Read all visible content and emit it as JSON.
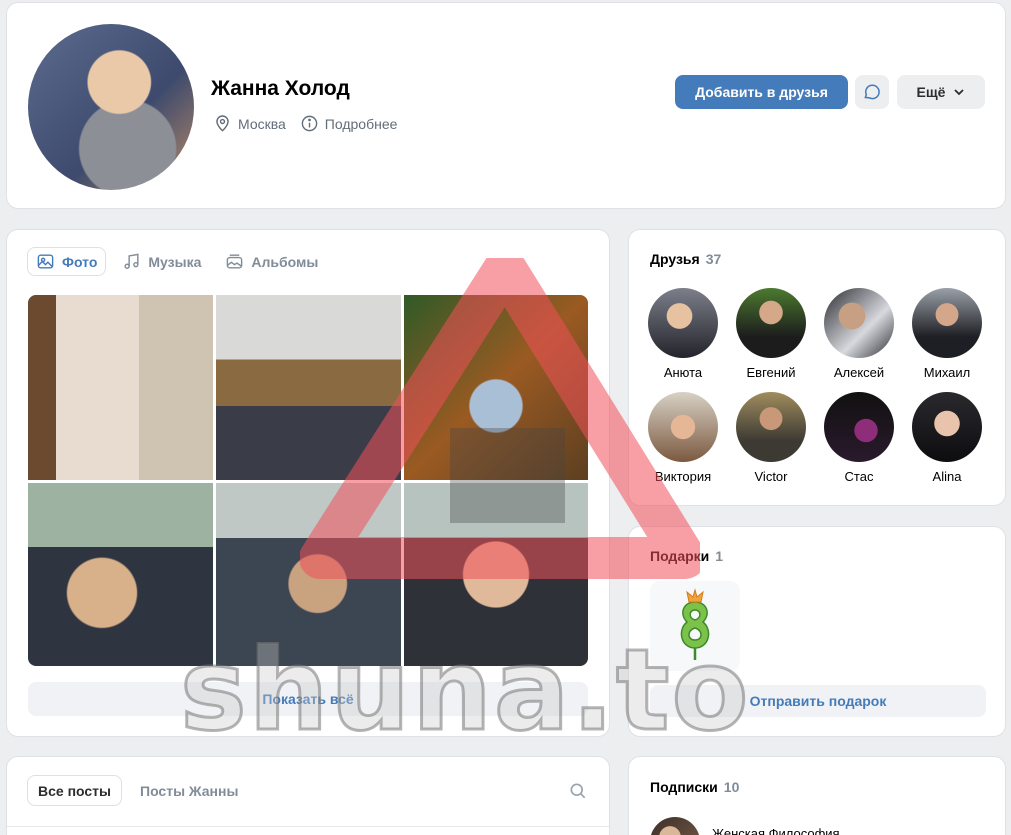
{
  "profile": {
    "name": "Жанна Холод",
    "city": "Москва",
    "details_label": "Подробнее",
    "add_friend_label": "Добавить в друзья",
    "more_label": "Ещё"
  },
  "photos_block": {
    "tabs": [
      {
        "label": "Фото",
        "icon": "photo-icon",
        "active": true
      },
      {
        "label": "Музыка",
        "icon": "music-icon",
        "active": false
      },
      {
        "label": "Альбомы",
        "icon": "albums-icon",
        "active": false
      }
    ],
    "show_all_label": "Показать всё",
    "photo_count_in_grid": 6
  },
  "friends": {
    "title": "Друзья",
    "count": "37",
    "items": [
      {
        "name": "Анюта"
      },
      {
        "name": "Евгений"
      },
      {
        "name": "Алексей"
      },
      {
        "name": "Михаил"
      },
      {
        "name": "Виктория"
      },
      {
        "name": "Victor"
      },
      {
        "name": "Стас"
      },
      {
        "name": "Alina"
      }
    ]
  },
  "gifts": {
    "title": "Подарки",
    "count": "1",
    "send_label": "Отправить подарок"
  },
  "posts": {
    "tabs": [
      {
        "label": "Все посты",
        "active": true
      },
      {
        "label": "Посты Жанны",
        "active": false
      }
    ]
  },
  "subscriptions": {
    "title": "Подписки",
    "count": "10",
    "first_item": "Женская Философия"
  },
  "watermark": {
    "text": "shuna.to"
  },
  "colors": {
    "accent": "#447bba",
    "background": "#edeef0",
    "muted_text": "#818c99"
  }
}
